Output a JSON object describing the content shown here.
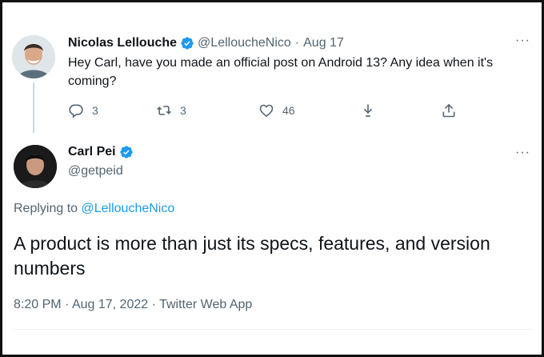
{
  "parent_tweet": {
    "author_name": "Nicolas Lellouche",
    "author_handle": "@LelloucheNico",
    "separator": "·",
    "date": "Aug 17",
    "text": "Hey Carl, have you made an official post on Android 13? Any idea when it's coming?",
    "more_label": "···",
    "reply_count": "3",
    "retweet_count": "3",
    "like_count": "46"
  },
  "main_tweet": {
    "author_name": "Carl Pei",
    "author_handle": "@getpeid",
    "replying_prefix": "Replying to",
    "replying_handle": "@LelloucheNico",
    "text": "A product is more than just its specs, features, and version numbers",
    "time": "8:20 PM",
    "separator": "·",
    "date": "Aug 17, 2022",
    "source": "Twitter Web App",
    "more_label": "···"
  },
  "colors": {
    "verified_blue": "#1d9bf0",
    "muted_text": "#536471",
    "primary_text": "#0f1419"
  }
}
